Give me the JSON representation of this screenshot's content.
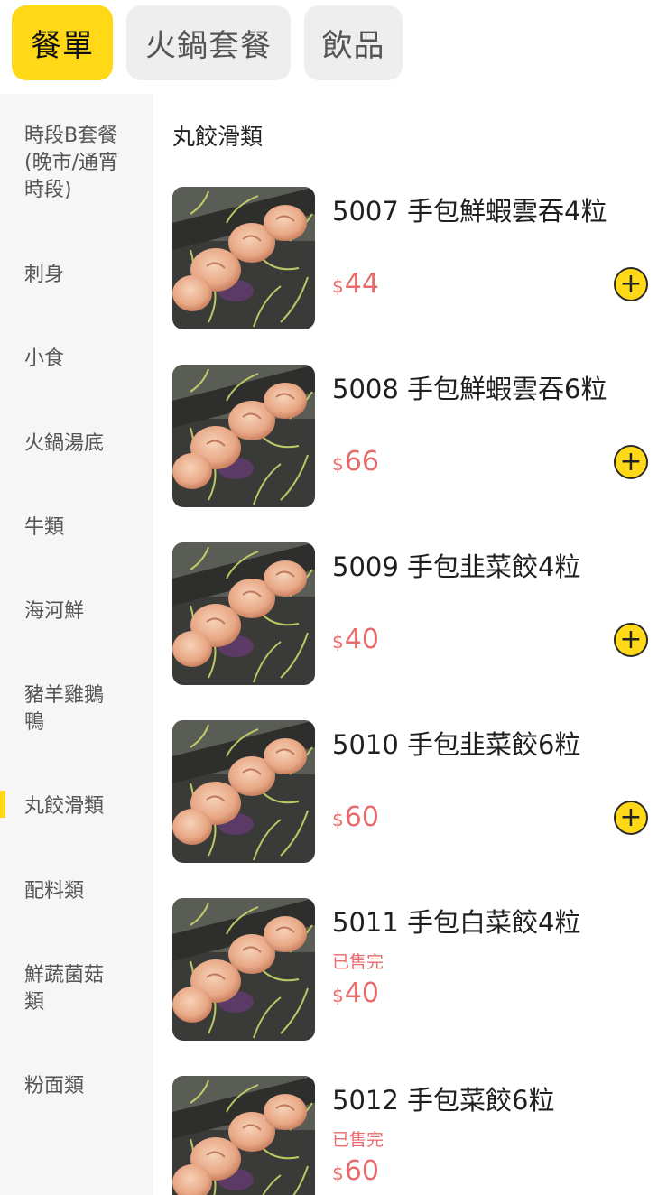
{
  "tabs": [
    {
      "label": "餐單",
      "active": true
    },
    {
      "label": "火鍋套餐",
      "active": false
    },
    {
      "label": "飲品",
      "active": false
    }
  ],
  "sidebar": {
    "items": [
      {
        "label": "時段B套餐(晚市/通宵時段)"
      },
      {
        "label": "刺身"
      },
      {
        "label": "小食"
      },
      {
        "label": "火鍋湯底"
      },
      {
        "label": "牛類"
      },
      {
        "label": "海河鮮"
      },
      {
        "label": "豬羊雞鵝鴨",
        "selected": true
      },
      {
        "label": "丸餃滑類"
      },
      {
        "label": "配料類"
      },
      {
        "label": "鮮蔬菌菇類"
      },
      {
        "label": "粉面類"
      }
    ]
  },
  "section": {
    "title": "丸餃滑類"
  },
  "currency": "$",
  "products": [
    {
      "name": "5007 手包鮮蝦雲吞4粒",
      "price": "44",
      "sold_out": false,
      "add_icon": "plus-circle-icon"
    },
    {
      "name": "5008 手包鮮蝦雲吞6粒",
      "price": "66",
      "sold_out": false,
      "add_icon": "plus-circle-icon"
    },
    {
      "name": "5009 手包韭菜餃4粒",
      "price": "40",
      "sold_out": false,
      "add_icon": "plus-circle-icon"
    },
    {
      "name": "5010 手包韭菜餃6粒",
      "price": "60",
      "sold_out": false,
      "add_icon": "plus-circle-icon"
    },
    {
      "name": "5011 手包白菜餃4粒",
      "price": "40",
      "sold_out": true,
      "sold_out_label": "已售完"
    },
    {
      "name": "5012 手包菜餃6粒",
      "price": "60",
      "sold_out": true,
      "sold_out_label": "已售完"
    }
  ],
  "colors": {
    "accent": "#ffd817",
    "price": "#e86b6b",
    "sidebar_bg": "#f6f6f6",
    "tab_bg": "#eeeeee"
  }
}
